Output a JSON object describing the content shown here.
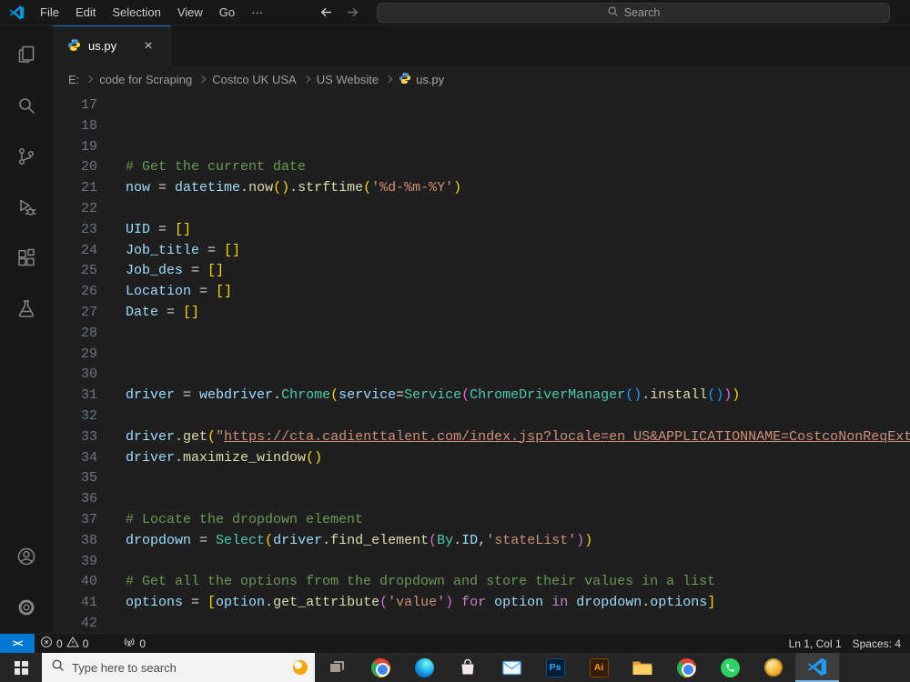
{
  "colors": {
    "accent": "#0078d4",
    "editor_bg": "#1f1f1f",
    "titlebar_bg": "#181818"
  },
  "title_bar": {
    "menus": [
      "File",
      "Edit",
      "Selection",
      "View",
      "Go"
    ],
    "more_label": "···",
    "search_placeholder": "Search"
  },
  "activity_bar": {
    "top": [
      "explorer",
      "search",
      "source-control",
      "run-debug",
      "extensions",
      "testing"
    ],
    "bottom": [
      "accounts",
      "settings"
    ]
  },
  "tab": {
    "label": "us.py",
    "close_label": "×"
  },
  "breadcrumbs": {
    "path": [
      "E:",
      "code for Scraping",
      "Costco UK USA",
      "US Website"
    ],
    "file": "us.py"
  },
  "editor": {
    "lines": [
      {
        "n": "17",
        "t": []
      },
      {
        "n": "18",
        "t": []
      },
      {
        "n": "19",
        "t": []
      },
      {
        "n": "20",
        "t": [
          [
            "c",
            "# Get the current date"
          ]
        ]
      },
      {
        "n": "21",
        "t": [
          [
            "v",
            "now"
          ],
          [
            "o",
            " = "
          ],
          [
            "v",
            "datetime"
          ],
          [
            "o",
            "."
          ],
          [
            "f",
            "now"
          ],
          [
            "b1",
            "()"
          ],
          [
            "o",
            "."
          ],
          [
            "f",
            "strftime"
          ],
          [
            "b1",
            "("
          ],
          [
            "s",
            "'%d-%m-%Y'"
          ],
          [
            "b1",
            ")"
          ]
        ]
      },
      {
        "n": "22",
        "t": []
      },
      {
        "n": "23",
        "t": [
          [
            "v",
            "UID"
          ],
          [
            "o",
            " = "
          ],
          [
            "b1",
            "[]"
          ]
        ]
      },
      {
        "n": "24",
        "t": [
          [
            "v",
            "Job_title"
          ],
          [
            "o",
            " = "
          ],
          [
            "b1",
            "[]"
          ]
        ]
      },
      {
        "n": "25",
        "t": [
          [
            "v",
            "Job_des"
          ],
          [
            "o",
            " = "
          ],
          [
            "b1",
            "[]"
          ]
        ]
      },
      {
        "n": "26",
        "t": [
          [
            "v",
            "Location"
          ],
          [
            "o",
            " = "
          ],
          [
            "b1",
            "[]"
          ]
        ]
      },
      {
        "n": "27",
        "t": [
          [
            "v",
            "Date"
          ],
          [
            "o",
            " = "
          ],
          [
            "b1",
            "[]"
          ]
        ]
      },
      {
        "n": "28",
        "t": []
      },
      {
        "n": "29",
        "t": []
      },
      {
        "n": "30",
        "t": []
      },
      {
        "n": "31",
        "t": [
          [
            "v",
            "driver"
          ],
          [
            "o",
            " = "
          ],
          [
            "v",
            "webdriver"
          ],
          [
            "o",
            "."
          ],
          [
            "y",
            "Chrome"
          ],
          [
            "b1",
            "("
          ],
          [
            "v",
            "service"
          ],
          [
            "o",
            "="
          ],
          [
            "y",
            "Service"
          ],
          [
            "b2",
            "("
          ],
          [
            "y",
            "ChromeDriverManager"
          ],
          [
            "b3",
            "()"
          ],
          [
            "o",
            "."
          ],
          [
            "f",
            "install"
          ],
          [
            "b3",
            "()"
          ],
          [
            "b2",
            ")"
          ],
          [
            "b1",
            ")"
          ]
        ]
      },
      {
        "n": "32",
        "t": []
      },
      {
        "n": "33",
        "t": [
          [
            "v",
            "driver"
          ],
          [
            "o",
            "."
          ],
          [
            "f",
            "get"
          ],
          [
            "b1",
            "("
          ],
          [
            "s",
            "\""
          ],
          [
            "u",
            "https://cta.cadienttalent.com/index.jsp?locale=en_US&APPLICATIONNAME=CostcoNonReqExt"
          ]
        ]
      },
      {
        "n": "34",
        "t": [
          [
            "v",
            "driver"
          ],
          [
            "o",
            "."
          ],
          [
            "f",
            "maximize_window"
          ],
          [
            "b1",
            "()"
          ]
        ]
      },
      {
        "n": "35",
        "t": []
      },
      {
        "n": "36",
        "t": []
      },
      {
        "n": "37",
        "t": [
          [
            "c",
            "# Locate the dropdown element"
          ]
        ]
      },
      {
        "n": "38",
        "t": [
          [
            "v",
            "dropdown"
          ],
          [
            "o",
            " = "
          ],
          [
            "y",
            "Select"
          ],
          [
            "b1",
            "("
          ],
          [
            "v",
            "driver"
          ],
          [
            "o",
            "."
          ],
          [
            "f",
            "find_element"
          ],
          [
            "b2",
            "("
          ],
          [
            "y",
            "By"
          ],
          [
            "o",
            "."
          ],
          [
            "v",
            "ID"
          ],
          [
            "o",
            ","
          ],
          [
            "s",
            "'stateList'"
          ],
          [
            "b2",
            ")"
          ],
          [
            "b1",
            ")"
          ]
        ]
      },
      {
        "n": "39",
        "t": []
      },
      {
        "n": "40",
        "t": [
          [
            "c",
            "# Get all the options from the dropdown and store their values in a list"
          ]
        ]
      },
      {
        "n": "41",
        "t": [
          [
            "v",
            "options"
          ],
          [
            "o",
            " = "
          ],
          [
            "b1",
            "["
          ],
          [
            "v",
            "option"
          ],
          [
            "o",
            "."
          ],
          [
            "f",
            "get_attribute"
          ],
          [
            "b2",
            "("
          ],
          [
            "s",
            "'value'"
          ],
          [
            "b2",
            ")"
          ],
          [
            "k",
            " for "
          ],
          [
            "v",
            "option"
          ],
          [
            "k",
            " in "
          ],
          [
            "v",
            "dropdown"
          ],
          [
            "o",
            "."
          ],
          [
            "v",
            "options"
          ],
          [
            "b1",
            "]"
          ]
        ]
      },
      {
        "n": "42",
        "t": []
      }
    ]
  },
  "status_bar": {
    "remote_icon": "><",
    "errors": "0",
    "warnings": "0",
    "broadcast": "0",
    "line_col": "Ln 1, Col 1",
    "indent": "Spaces: 4"
  },
  "taskbar": {
    "search_placeholder": "Type here to search",
    "apps": [
      {
        "name": "task-view"
      },
      {
        "name": "chrome"
      },
      {
        "name": "edge"
      },
      {
        "name": "store"
      },
      {
        "name": "mail"
      },
      {
        "name": "photoshop",
        "label": "Ps"
      },
      {
        "name": "illustrator",
        "label": "Ai"
      },
      {
        "name": "file-explorer"
      },
      {
        "name": "chrome-2"
      },
      {
        "name": "whatsapp"
      },
      {
        "name": "coin"
      },
      {
        "name": "vscode",
        "active": true
      }
    ]
  }
}
